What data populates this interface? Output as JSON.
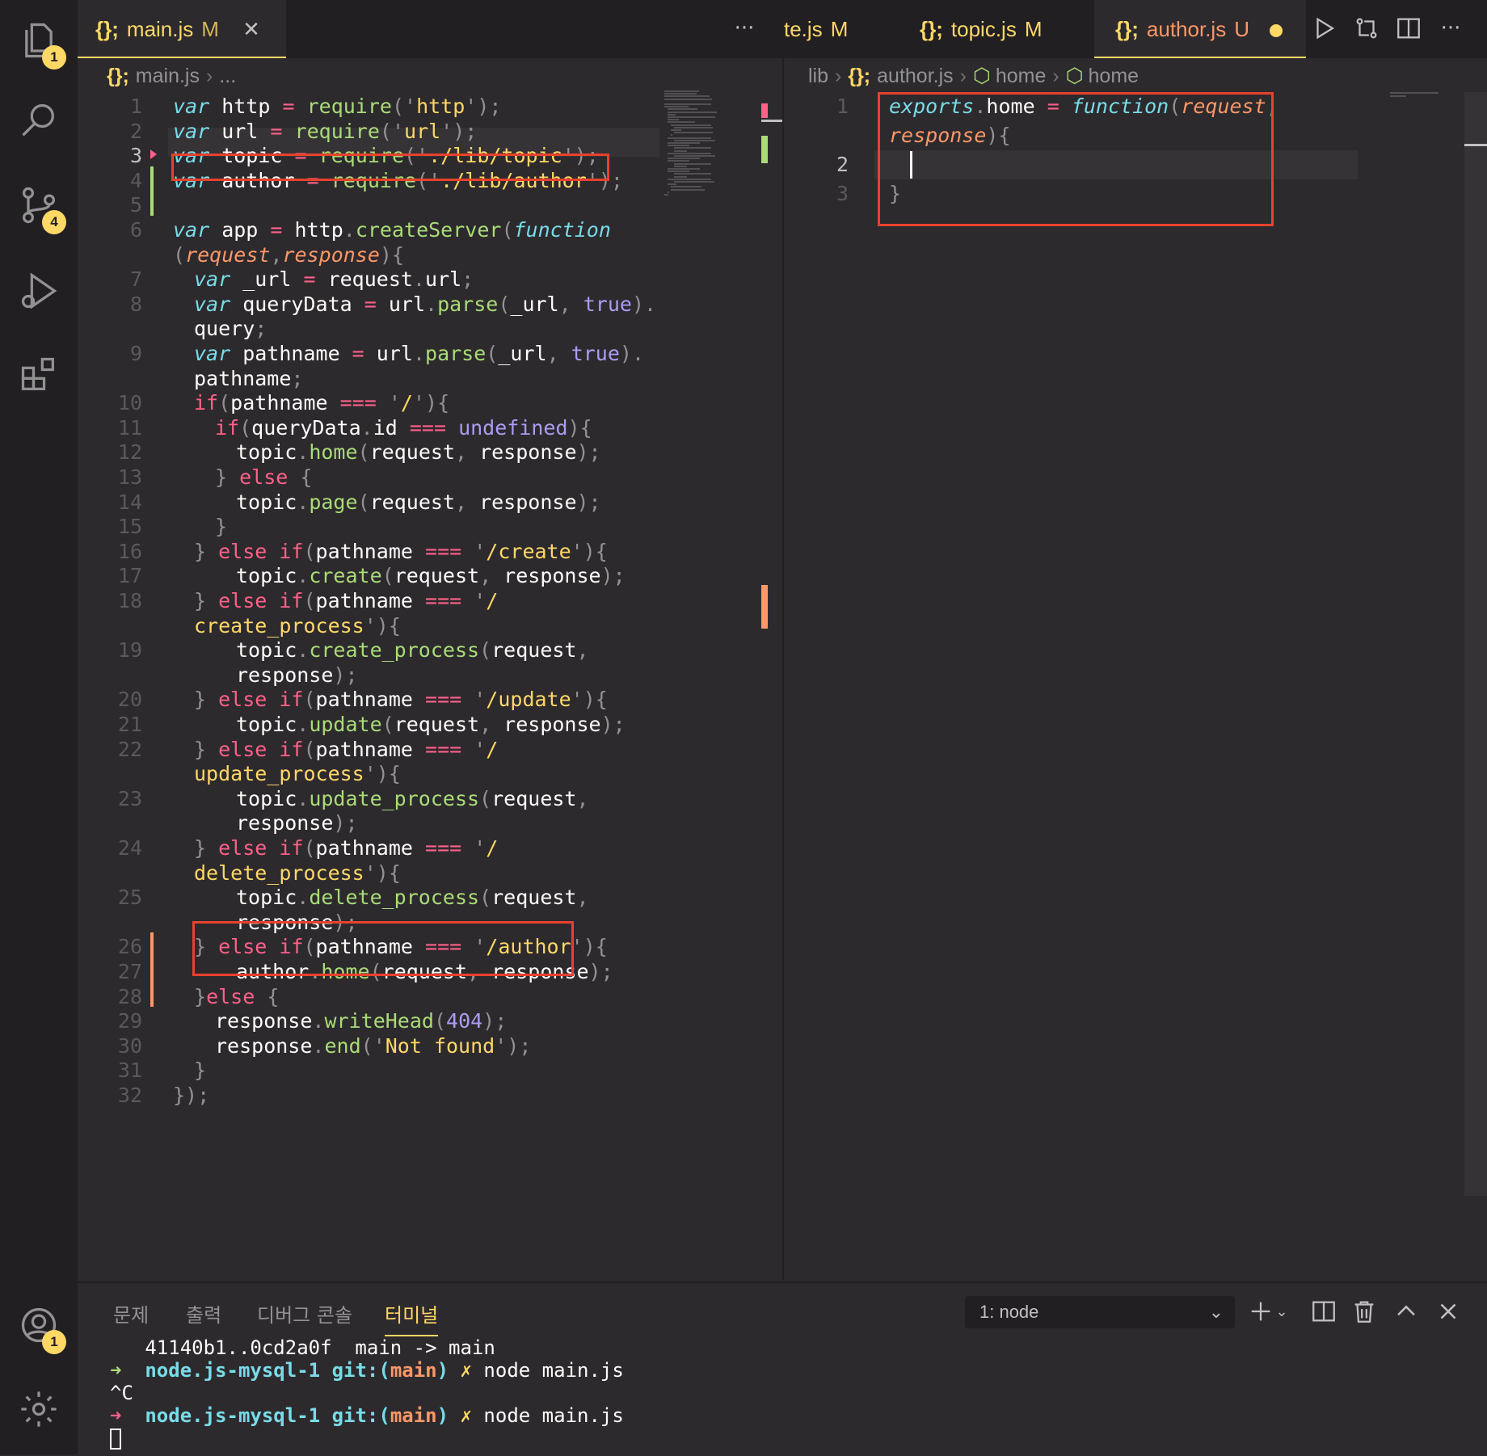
{
  "activity_bar": {
    "explorer_badge": "1",
    "scm_badge": "4",
    "accounts_badge": "1"
  },
  "left_editor": {
    "tab": {
      "icon": "{};",
      "label": "main.js",
      "status": "M"
    },
    "more": "···",
    "breadcrumb": {
      "icon": "{};",
      "file": "main.js",
      "rest": "..."
    },
    "lines": [
      "1",
      "2",
      "3",
      "4",
      "5",
      "6",
      "",
      "7",
      "8",
      "",
      "9",
      "",
      "10",
      "11",
      "12",
      "13",
      "14",
      "15",
      "16",
      "17",
      "18",
      "",
      "19",
      "",
      "20",
      "21",
      "22",
      "",
      "23",
      "",
      "24",
      "",
      "25",
      "",
      "26",
      "27",
      "28",
      "29",
      "30",
      "31",
      "32"
    ]
  },
  "right_editor": {
    "tabs": [
      {
        "icon": "",
        "label": "te.js",
        "status": "M"
      },
      {
        "icon": "{};",
        "label": "topic.js",
        "status": "M"
      },
      {
        "icon": "{};",
        "label": "author.js",
        "status": "U"
      }
    ],
    "breadcrumb": [
      "lib",
      "author.js",
      "home",
      "home"
    ],
    "lines": [
      "1",
      "",
      "2",
      "3"
    ]
  },
  "panel": {
    "tabs": [
      "문제",
      "출력",
      "디버그 콘솔",
      "터미널"
    ],
    "terminal_select": "1: node",
    "terminal": {
      "line1": "   41140b1..0cd2a0f  main -> main",
      "prompt_arrow": "➜",
      "dir": "node.js-mysql-1",
      "git_label": "git:(",
      "branch": "main",
      "git_close": ")",
      "x_mark": "✗",
      "cmd": "node main.js",
      "ctrlc": "^C"
    }
  },
  "colors": {
    "accent": "#ffd866",
    "highlight_box": "#e8412d",
    "added": "#a9dc76",
    "modified": "#fc9867"
  }
}
